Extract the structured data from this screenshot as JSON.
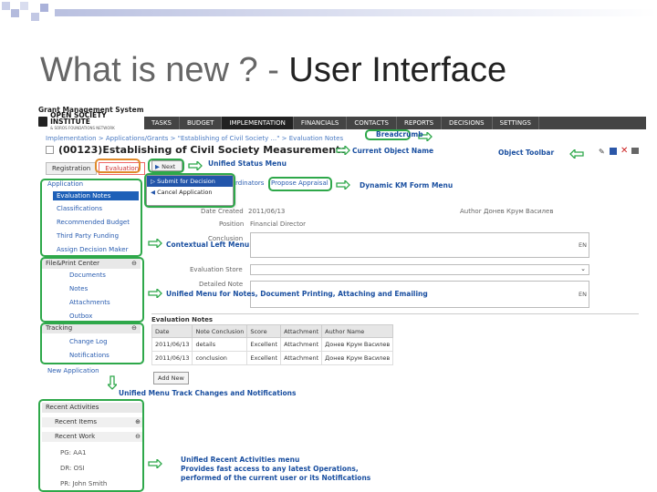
{
  "slide": {
    "title_part1": "What is new ? - ",
    "title_part2": "User Interface"
  },
  "app": {
    "system_name": "Grant Management System",
    "org_name": "OPEN SOCIETY INSTITUTE",
    "org_sub": "& SOROS FOUNDATIONS NETWORK",
    "nav": [
      "TASKS",
      "BUDGET",
      "IMPLEMENTATION",
      "FINANCIALS",
      "CONTACTS",
      "REPORTS",
      "DECISIONS",
      "SETTINGS"
    ],
    "breadcrumb": "Implementation  >  Applications/Grants  >  \"Establishing of Civil Society ...\"  >  Evaluation Notes",
    "object_name": "(00123)Establishing of Civil Society Measurements",
    "tabs": [
      "Registration",
      "Evaluation"
    ],
    "status_next": "Next",
    "popup": {
      "item1": "Submit for Decision",
      "item2": "Cancel Application"
    },
    "coordinators": "rdinators",
    "propose_appraisal": "Propose Appraisal",
    "left_menu": {
      "application": "Application",
      "items": [
        "Evaluation Notes",
        "Classifications",
        "Recommended Budget",
        "Third Party Funding",
        "Assign Decision Maker"
      ],
      "file_print": "File&Print Center",
      "file_items": [
        "Documents",
        "Notes",
        "Attachments",
        "Outbox"
      ],
      "tracking": "Tracking",
      "tracking_items": [
        "Change Log",
        "Notifications"
      ],
      "new_application": "New Application",
      "recent_activities": "Recent Activities",
      "recent_items": "Recent Items",
      "recent_work": "Recent Work",
      "recent_list": [
        "PG: AA1",
        "DR: OSI",
        "PR: John Smith"
      ]
    },
    "form": {
      "date_created_label": "Date Created",
      "date_created_value": "2011/06/13",
      "author_label": "Author",
      "author_value": "Донев Крум Василев",
      "position_label": "Position",
      "position_value": "Financial Director",
      "conclusion_label": "Conclusion",
      "evaluation_store_label": "Evaluation Store",
      "detailed_note_label": "Detailed Note",
      "lang_en": "EN"
    },
    "notes": {
      "title": "Evaluation Notes",
      "headers": [
        "Date",
        "Note Conclusion",
        "Score",
        "Attachment",
        "Author Name"
      ],
      "rows": [
        [
          "2011/06/13",
          "details",
          "Excellent",
          "Attachment",
          "Донев Крум Василев"
        ],
        [
          "2011/06/13",
          "conclusion",
          "Excellent",
          "Attachment",
          "Донев Крум Василев"
        ]
      ],
      "add_button": "Add New"
    }
  },
  "annotations": {
    "breadcrumb": "Breadcrumb",
    "object_name": "Current Object Name",
    "object_toolbar": "Object Toolbar",
    "status_menu": "Unified Status Menu",
    "km_form": "Dynamic KM Form Menu",
    "contextual_left": "Contextual Left Menu",
    "unified_notes": "Unified Menu for Notes, Document Printing, Attaching and Emailing",
    "track_changes": "Unified Menu Track Changes and Notifications",
    "recent_line1": "Unified Recent Activities menu",
    "recent_line2": "Provides fast access to any latest Operations,",
    "recent_line3": "performed of the current user or its Notifications"
  },
  "colors": {
    "accent_green": "#2ea84a",
    "annotation_blue": "#1a4fa0",
    "nav_bg": "#444444",
    "selected_blue": "#1e60b8"
  }
}
